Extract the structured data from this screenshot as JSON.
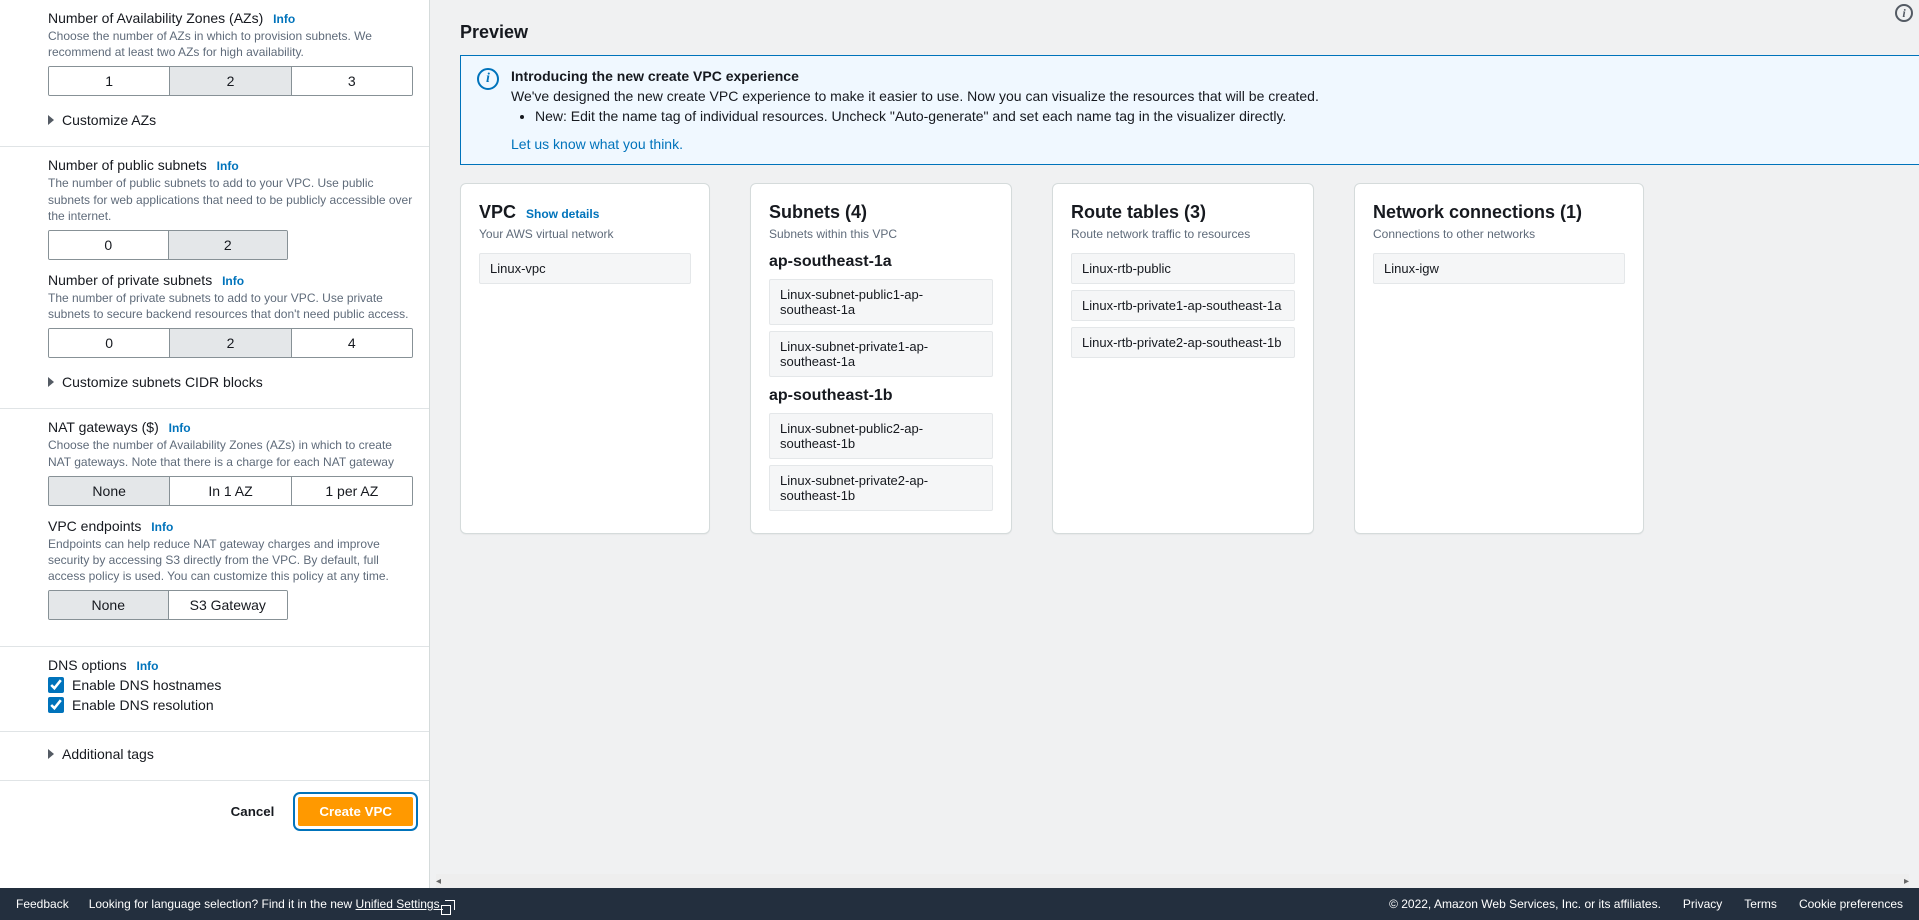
{
  "form": {
    "azs": {
      "label": "Number of Availability Zones (AZs)",
      "info": "Info",
      "hint": "Choose the number of AZs in which to provision subnets. We recommend at least two AZs for high availability.",
      "options": [
        "1",
        "2",
        "3"
      ],
      "selected": "2",
      "customize": "Customize AZs"
    },
    "publicSubnets": {
      "label": "Number of public subnets",
      "info": "Info",
      "hint": "The number of public subnets to add to your VPC. Use public subnets for web applications that need to be publicly accessible over the internet.",
      "options": [
        "0",
        "2"
      ],
      "selected": "2"
    },
    "privateSubnets": {
      "label": "Number of private subnets",
      "info": "Info",
      "hint": "The number of private subnets to add to your VPC. Use private subnets to secure backend resources that don't need public access.",
      "options": [
        "0",
        "2",
        "4"
      ],
      "selected": "2",
      "customize": "Customize subnets CIDR blocks"
    },
    "nat": {
      "label": "NAT gateways ($)",
      "info": "Info",
      "hint": "Choose the number of Availability Zones (AZs) in which to create NAT gateways. Note that there is a charge for each NAT gateway",
      "options": [
        "None",
        "In 1 AZ",
        "1 per AZ"
      ],
      "selected": "None"
    },
    "vpcEndpoints": {
      "label": "VPC endpoints",
      "info": "Info",
      "hint": "Endpoints can help reduce NAT gateway charges and improve security by accessing S3 directly from the VPC. By default, full access policy is used. You can customize this policy at any time.",
      "options": [
        "None",
        "S3 Gateway"
      ],
      "selected": "None"
    },
    "dns": {
      "label": "DNS options",
      "info": "Info",
      "hostnames": "Enable DNS hostnames",
      "resolution": "Enable DNS resolution"
    },
    "additionalTags": "Additional tags",
    "cancel": "Cancel",
    "create": "Create VPC"
  },
  "preview": {
    "title": "Preview",
    "banner": {
      "title": "Introducing the new create VPC experience",
      "text": "We've designed the new create VPC experience to make it easier to use. Now you can visualize the resources that will be created.",
      "bullet": "New: Edit the name tag of individual resources. Uncheck \"Auto-generate\" and set each name tag in the visualizer directly.",
      "link": "Let us know what you think."
    },
    "vpc": {
      "title": "VPC",
      "link": "Show details",
      "sub": "Your AWS virtual network",
      "items": [
        "Linux-vpc"
      ]
    },
    "subnets": {
      "title": "Subnets (4)",
      "sub": "Subnets within this VPC",
      "az1": "ap-southeast-1a",
      "az1Items": [
        "Linux-subnet-public1-ap-southeast-1a",
        "Linux-subnet-private1-ap-southeast-1a"
      ],
      "az2": "ap-southeast-1b",
      "az2Items": [
        "Linux-subnet-public2-ap-southeast-1b",
        "Linux-subnet-private2-ap-southeast-1b"
      ]
    },
    "routeTables": {
      "title": "Route tables (3)",
      "sub": "Route network traffic to resources",
      "items": [
        "Linux-rtb-public",
        "Linux-rtb-private1-ap-southeast-1a",
        "Linux-rtb-private2-ap-southeast-1b"
      ]
    },
    "network": {
      "title": "Network connections (1)",
      "sub": "Connections to other networks",
      "items": [
        "Linux-igw"
      ]
    }
  },
  "footer": {
    "feedback": "Feedback",
    "lang": "Looking for language selection? Find it in the new ",
    "settings": "Unified Settings",
    "copyright": "© 2022, Amazon Web Services, Inc. or its affiliates.",
    "privacy": "Privacy",
    "terms": "Terms",
    "cookie": "Cookie preferences"
  }
}
